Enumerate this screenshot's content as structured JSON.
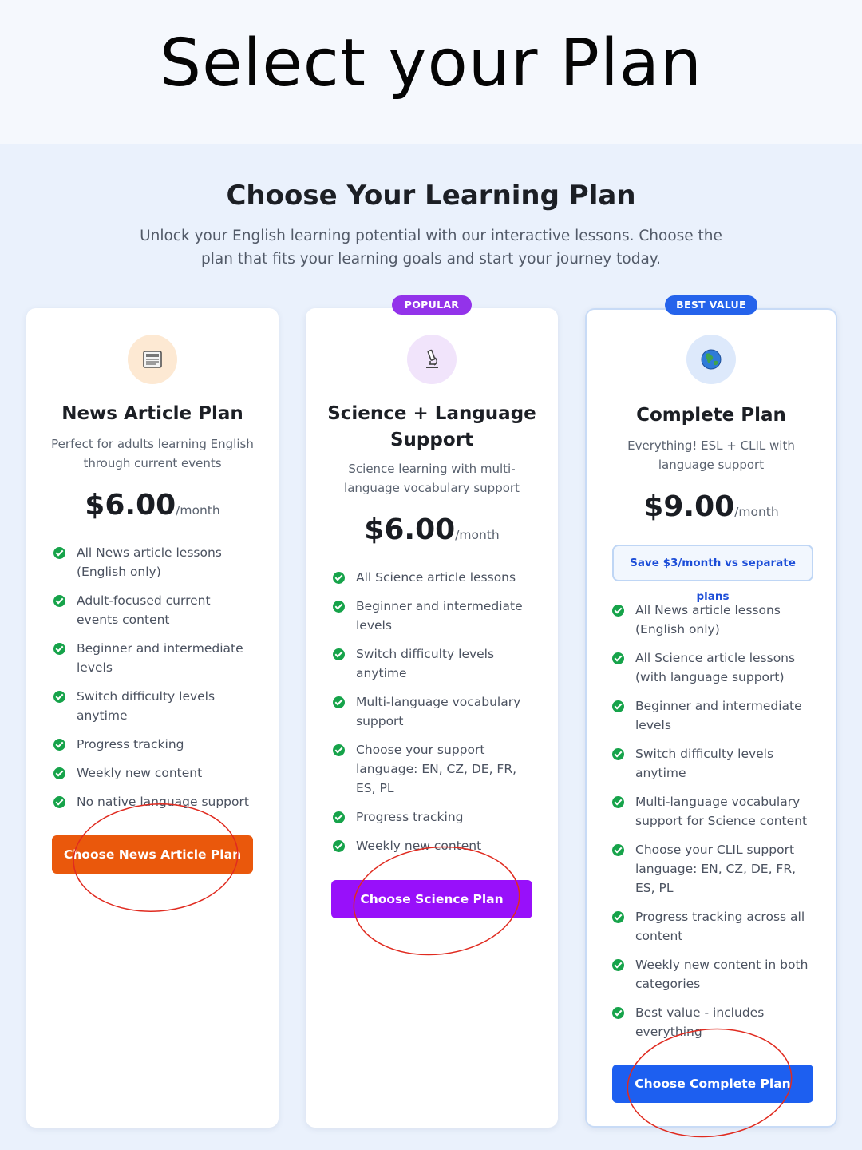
{
  "top": {
    "title": "Select your Plan"
  },
  "section": {
    "heading": "Choose Your Learning Plan",
    "subheading": "Unlock your English learning potential with our interactive lessons. Choose the plan that fits your learning goals and start your journey today."
  },
  "plans": [
    {
      "icon": "newspaper-icon",
      "icon_bg": "#fde9d3",
      "name": "News Article Plan",
      "desc": "Perfect for adults learning English through current events",
      "price": "$6.00",
      "per": "/month",
      "features": [
        "All News article lessons (English only)",
        "Adult-focused current events content",
        "Beginner and intermediate levels",
        "Switch difficulty levels anytime",
        "Progress tracking",
        "Weekly new content",
        "No native language support"
      ],
      "cta": "Choose News Article Plan",
      "cta_color": "#ea580c"
    },
    {
      "badge": "POPULAR",
      "icon": "microscope-icon",
      "icon_bg": "#f1e4fb",
      "name": "Science + Language Support",
      "desc": "Science learning with multi-language vocabulary support",
      "price": "$6.00",
      "per": "/month",
      "features": [
        "All Science article lessons",
        "Beginner and intermediate levels",
        "Switch difficulty levels anytime",
        "Multi-language vocabulary support",
        "Choose your support language: EN, CZ, DE, FR, ES, PL",
        "Progress tracking",
        "Weekly new content"
      ],
      "cta": "Choose Science Plan",
      "cta_color": "#9810fa"
    },
    {
      "badge": "BEST VALUE",
      "icon": "globe-icon",
      "icon_bg": "#dde9fb",
      "name": "Complete Plan",
      "desc": "Everything! ESL + CLIL with language support",
      "price": "$9.00",
      "per": "/month",
      "savings": "Save $3/month vs separate plans",
      "features": [
        "All News article lessons (English only)",
        "All Science article lessons (with language support)",
        "Beginner and intermediate levels",
        "Switch difficulty levels anytime",
        "Multi-language vocabulary support for Science content",
        "Choose your CLIL support language: EN, CZ, DE, FR, ES, PL",
        "Progress tracking across all content",
        "Weekly new content in both categories",
        "Best value - includes everything"
      ],
      "cta": "Choose Complete Plan",
      "cta_color": "#1d5ff0"
    }
  ],
  "annotation_color": "#e02b20"
}
